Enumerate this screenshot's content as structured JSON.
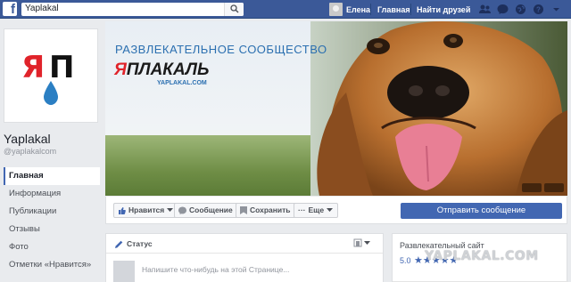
{
  "topbar": {
    "search_value": "Yaplakal",
    "user_name": "Елена",
    "home_label": "Главная",
    "find_friends_label": "Найти друзей",
    "brand_color": "#3b5998"
  },
  "page": {
    "name": "Yaplakal",
    "handle": "@yaplakalcom",
    "logo_text": "ЯП"
  },
  "left_nav": {
    "items": [
      {
        "label": "Главная",
        "active": true
      },
      {
        "label": "Информация"
      },
      {
        "label": "Публикации"
      },
      {
        "label": "Отзывы"
      },
      {
        "label": "Фото"
      },
      {
        "label": "Отметки «Нравится»"
      }
    ]
  },
  "cover": {
    "title": "РАЗВЛЕКАТЕЛЬНОЕ СООБЩЕСТВО",
    "brand_first": "Я",
    "brand_rest": "ПЛАКАЛЬ",
    "url": "YAPLAKAL.COM"
  },
  "actions": {
    "like": "Нравится",
    "message": "Сообщение",
    "save": "Сохранить",
    "more": "Еще",
    "send_message": "Отправить сообщение"
  },
  "composer": {
    "tab_status": "Статус",
    "placeholder": "Напишите что-нибудь на этой Странице..."
  },
  "about": {
    "category": "Развлекательный сайт",
    "rating": "5.0",
    "stars": "★★★★★"
  },
  "watermark": "YAPLAKAL.COM",
  "colors": {
    "accent": "#4267b2",
    "logo_red": "#e0232a"
  }
}
